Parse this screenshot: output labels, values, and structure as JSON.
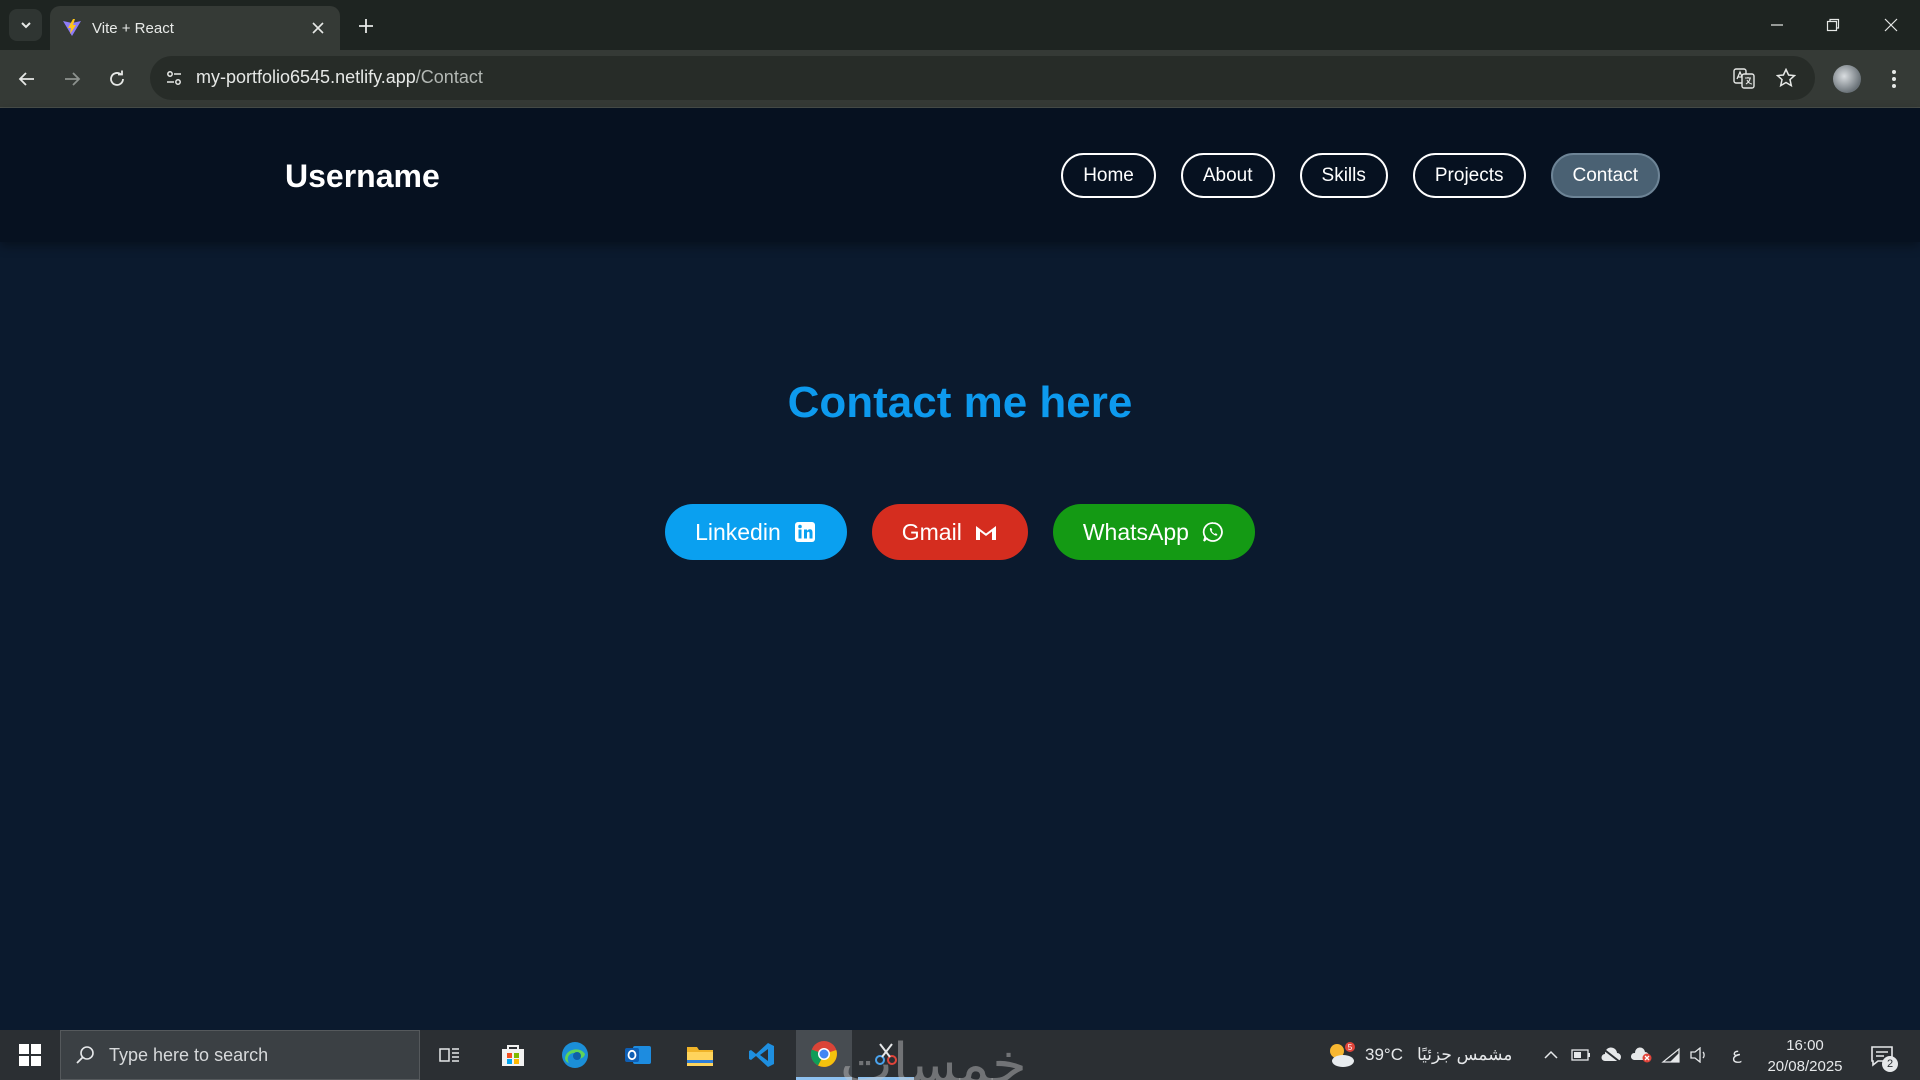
{
  "browser": {
    "tab_title": "Vite + React",
    "url_host": "my-portfolio6545.netlify.app",
    "url_path": "/Contact"
  },
  "site": {
    "brand": "Username",
    "nav": [
      {
        "label": "Home",
        "active": false
      },
      {
        "label": "About",
        "active": false
      },
      {
        "label": "Skills",
        "active": false
      },
      {
        "label": "Projects",
        "active": false
      },
      {
        "label": "Contact",
        "active": true
      }
    ]
  },
  "contact": {
    "title": "Contact me here",
    "buttons": [
      {
        "label": "Linkedin",
        "icon": "linkedin-icon",
        "color": "#0aa0f0"
      },
      {
        "label": "Gmail",
        "icon": "gmail-icon",
        "color": "#d52d1f"
      },
      {
        "label": "WhatsApp",
        "icon": "whatsapp-icon",
        "color": "#149a14"
      }
    ]
  },
  "taskbar": {
    "search_placeholder": "Type here to search",
    "watermark": "خمسات",
    "weather_temp": "39°C",
    "weather_text": "مشمس جزئيًا",
    "weather_badge": "5",
    "ime": "ع",
    "time": "16:00",
    "date": "20/08/2025",
    "notification_count": "2"
  },
  "colors": {
    "page_bg": "#0b1a2e",
    "header_bg": "#061120",
    "title_accent": "#0d9aee",
    "active_nav": "#4a6173"
  }
}
